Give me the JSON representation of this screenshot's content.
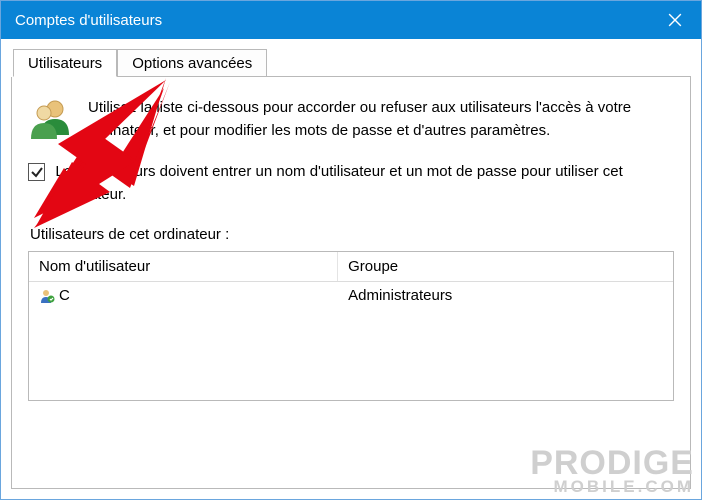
{
  "window": {
    "title": "Comptes d'utilisateurs"
  },
  "tabs": [
    {
      "label": "Utilisateurs",
      "active": true
    },
    {
      "label": "Options avancées",
      "active": false
    }
  ],
  "intro_text": "Utilisez la liste ci-dessous pour accorder ou refuser aux utilisateurs l'accès à votre ordinateur, et pour modifier les mots de passe et d'autres paramètres.",
  "require_login": {
    "checked": true,
    "label": "Les utilisateurs doivent entrer un nom d'utilisateur et un mot de passe pour utiliser cet ordinateur."
  },
  "users_list": {
    "heading": "Utilisateurs de cet ordinateur :",
    "columns": {
      "name": "Nom d'utilisateur",
      "group": "Groupe"
    },
    "rows": [
      {
        "name": "C",
        "group": "Administrateurs"
      }
    ]
  },
  "watermark": {
    "line1": "PRODIGE",
    "line2": "MOBILE.COM"
  }
}
